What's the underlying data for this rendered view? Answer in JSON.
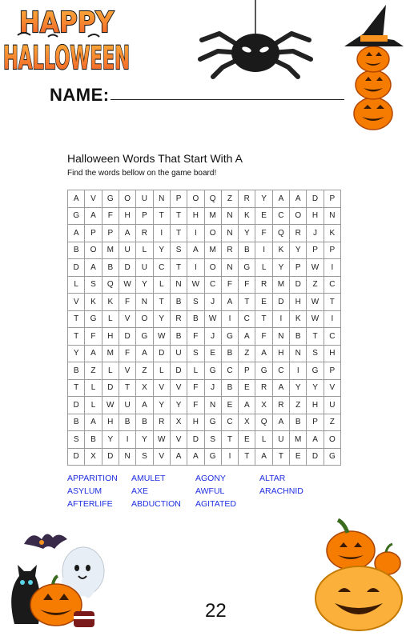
{
  "header": {
    "logo_text": "HAPPY HALLOWEEN",
    "name_label": "NAME:"
  },
  "puzzle": {
    "title": "Halloween Words That Start With A",
    "instructions": "Find the words bellow on the game board!",
    "grid": [
      [
        "A",
        "V",
        "G",
        "O",
        "U",
        "N",
        "P",
        "O",
        "Q",
        "Z",
        "R",
        "Y",
        "A",
        "A",
        "D",
        "P"
      ],
      [
        "G",
        "A",
        "F",
        "H",
        "P",
        "T",
        "T",
        "H",
        "M",
        "N",
        "K",
        "E",
        "C",
        "O",
        "H",
        "N"
      ],
      [
        "A",
        "P",
        "P",
        "A",
        "R",
        "I",
        "T",
        "I",
        "O",
        "N",
        "Y",
        "F",
        "Q",
        "R",
        "J",
        "K"
      ],
      [
        "B",
        "O",
        "M",
        "U",
        "L",
        "Y",
        "S",
        "A",
        "M",
        "R",
        "B",
        "I",
        "K",
        "Y",
        "P",
        "P"
      ],
      [
        "D",
        "A",
        "B",
        "D",
        "U",
        "C",
        "T",
        "I",
        "O",
        "N",
        "G",
        "L",
        "Y",
        "P",
        "W",
        "I"
      ],
      [
        "L",
        "S",
        "Q",
        "W",
        "Y",
        "L",
        "N",
        "W",
        "C",
        "F",
        "F",
        "R",
        "M",
        "D",
        "Z",
        "C"
      ],
      [
        "V",
        "K",
        "K",
        "F",
        "N",
        "T",
        "B",
        "S",
        "J",
        "A",
        "T",
        "E",
        "D",
        "H",
        "W",
        "T"
      ],
      [
        "T",
        "G",
        "L",
        "V",
        "O",
        "Y",
        "R",
        "B",
        "W",
        "I",
        "C",
        "T",
        "I",
        "K",
        "W",
        "I"
      ],
      [
        "T",
        "F",
        "H",
        "D",
        "G",
        "W",
        "B",
        "F",
        "J",
        "G",
        "A",
        "F",
        "N",
        "B",
        "T",
        "C"
      ],
      [
        "Y",
        "A",
        "M",
        "F",
        "A",
        "D",
        "U",
        "S",
        "E",
        "B",
        "Z",
        "A",
        "H",
        "N",
        "S",
        "H"
      ],
      [
        "B",
        "Z",
        "L",
        "V",
        "Z",
        "L",
        "D",
        "L",
        "G",
        "C",
        "P",
        "G",
        "C",
        "I",
        "G",
        "P"
      ],
      [
        "T",
        "L",
        "D",
        "T",
        "X",
        "V",
        "V",
        "F",
        "J",
        "B",
        "E",
        "R",
        "A",
        "Y",
        "Y",
        "V"
      ],
      [
        "D",
        "L",
        "W",
        "U",
        "A",
        "Y",
        "Y",
        "F",
        "N",
        "E",
        "A",
        "X",
        "R",
        "Z",
        "H",
        "U"
      ],
      [
        "B",
        "A",
        "H",
        "B",
        "B",
        "R",
        "X",
        "H",
        "G",
        "C",
        "X",
        "Q",
        "A",
        "B",
        "P",
        "Z"
      ],
      [
        "S",
        "B",
        "Y",
        "I",
        "Y",
        "W",
        "V",
        "D",
        "S",
        "T",
        "E",
        "L",
        "U",
        "M",
        "A",
        "O"
      ],
      [
        "D",
        "X",
        "D",
        "N",
        "S",
        "V",
        "A",
        "A",
        "G",
        "I",
        "T",
        "A",
        "T",
        "E",
        "D",
        "G"
      ]
    ],
    "word_list": [
      "APPARITION",
      "AMULET",
      "AGONY",
      "ALTAR",
      "ASYLUM",
      "AXE",
      "AWFUL",
      "ARACHNID",
      "AFTERLIFE",
      "ABDUCTION",
      "AGITATED"
    ]
  },
  "footer": {
    "page_number": "22"
  },
  "colors": {
    "word_list": "#1e2fe0",
    "logo_orange": "#f7931e",
    "pumpkin_orange": "#f57c00",
    "grid_border": "#9a9a9a"
  }
}
